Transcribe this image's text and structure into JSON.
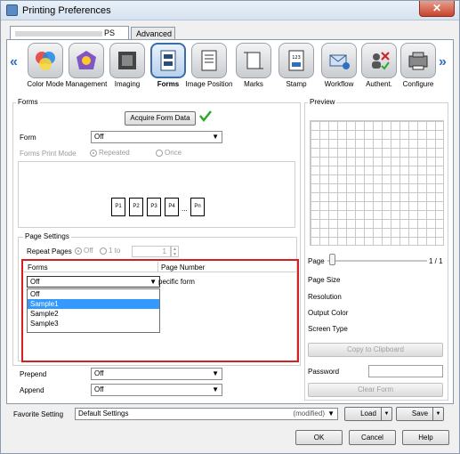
{
  "window": {
    "title": "Printing Preferences",
    "close_label": "✕"
  },
  "tabs": [
    {
      "label": "PS"
    },
    {
      "label": "Advanced"
    }
  ],
  "toolbar": {
    "prev": "«",
    "next": "»",
    "items": [
      {
        "label": "Color Mode",
        "icon": "color-mode-icon"
      },
      {
        "label": "Management",
        "icon": "management-icon"
      },
      {
        "label": "Imaging",
        "icon": "imaging-icon"
      },
      {
        "label": "Forms",
        "icon": "forms-icon"
      },
      {
        "label": "Image Position",
        "icon": "image-position-icon"
      },
      {
        "label": "Marks",
        "icon": "marks-icon"
      },
      {
        "label": "Stamp",
        "icon": "stamp-icon"
      },
      {
        "label": "Workflow",
        "icon": "workflow-icon"
      },
      {
        "label": "Authent.",
        "icon": "authentication-icon"
      },
      {
        "label": "Configure",
        "icon": "configure-icon"
      }
    ],
    "active_index": 3
  },
  "forms": {
    "group_title": "Forms",
    "acquire_button": "Acquire Form Data",
    "form_label": "Form",
    "form_value": "Off",
    "print_mode_label": "Forms Print Mode",
    "repeated": "Repeated",
    "once": "Once",
    "pages": [
      "P1",
      "P2",
      "P3",
      "P4",
      "...",
      "Pn"
    ]
  },
  "page_settings": {
    "group_title": "Page Settings",
    "repeat_label": "Repeat Pages",
    "off": "Off",
    "range_1": "1 to",
    "range_value": "1",
    "col_forms": "Forms",
    "col_page_number": "Page Number",
    "forms_value": "Off",
    "page_number_text": "pecific form",
    "dropdown_options": [
      "Off",
      "Sample1",
      "Sample2",
      "Sample3"
    ],
    "dropdown_selected_index": 1
  },
  "prepend": {
    "label": "Prepend",
    "value": "Off"
  },
  "append": {
    "label": "Append",
    "value": "Off"
  },
  "preview": {
    "title": "Preview",
    "page_label": "Page",
    "page_count": "1 / 1",
    "page_size": "Page Size",
    "resolution": "Resolution",
    "output_color": "Output Color",
    "screen_type": "Screen Type",
    "copy_button": "Copy to Clipboard",
    "password_label": "Password",
    "clear_form_button": "Clear Form"
  },
  "favorite": {
    "label": "Favorite Setting",
    "value": "Default Settings",
    "modified": "(modified)",
    "load": "Load",
    "save": "Save"
  },
  "buttons": {
    "ok": "OK",
    "cancel": "Cancel",
    "help": "Help"
  },
  "colors": {
    "accent": "#2f6fc0",
    "highlight_box": "#d42020",
    "selection": "#3399ff",
    "check": "#2fa82f"
  }
}
